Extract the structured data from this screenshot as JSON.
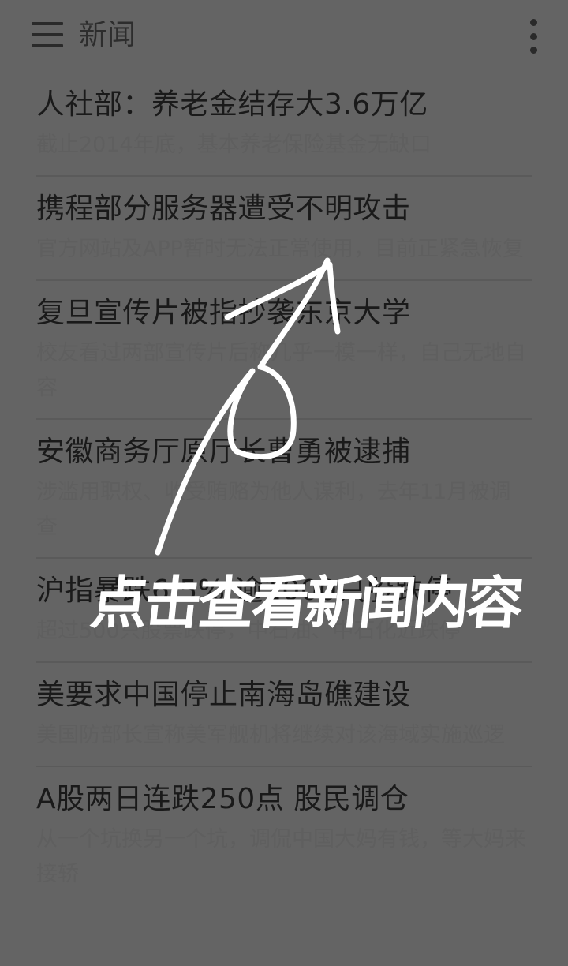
{
  "appbar": {
    "title": "新闻",
    "menu_icon": "hamburger-menu-icon",
    "overflow_icon": "more-vertical-icon"
  },
  "news": [
    {
      "title": "人社部：养老金结存大3.6万亿",
      "summary": "截止2014年底，基本养老保险基金无缺口"
    },
    {
      "title": "携程部分服务器遭受不明攻击",
      "summary": "官方网站及APP暂时无法正常使用，目前正紧急恢复"
    },
    {
      "title": "复旦宣传片被指抄袭东京大学",
      "summary": "校友看过两部宣传片后称几乎一模一样，自己无地自容"
    },
    {
      "title": "安徽商务厅原厅长曹勇被逮捕",
      "summary": "涉滥用职权、收受贿赂为他人谋利，去年11月被调查"
    },
    {
      "title": "沪指暴跌6.5% 逾1000只股跌停",
      "summary": "超过500只股票跌停，中石油、中石化近跌停"
    },
    {
      "title": "美要求中国停止南海岛礁建设",
      "summary": "美国防部长宣称美军舰机将继续对该海域实施巡逻"
    },
    {
      "title": "A股两日连跌250点 股民调仓",
      "summary": "从一个坑换另一个坑，调侃中国大妈有钱，等大妈来接轿"
    }
  ],
  "overlay": {
    "hint": "点击查看新闻内容",
    "colors": {
      "dim": "#646464",
      "stroke": "#ffffff"
    }
  }
}
